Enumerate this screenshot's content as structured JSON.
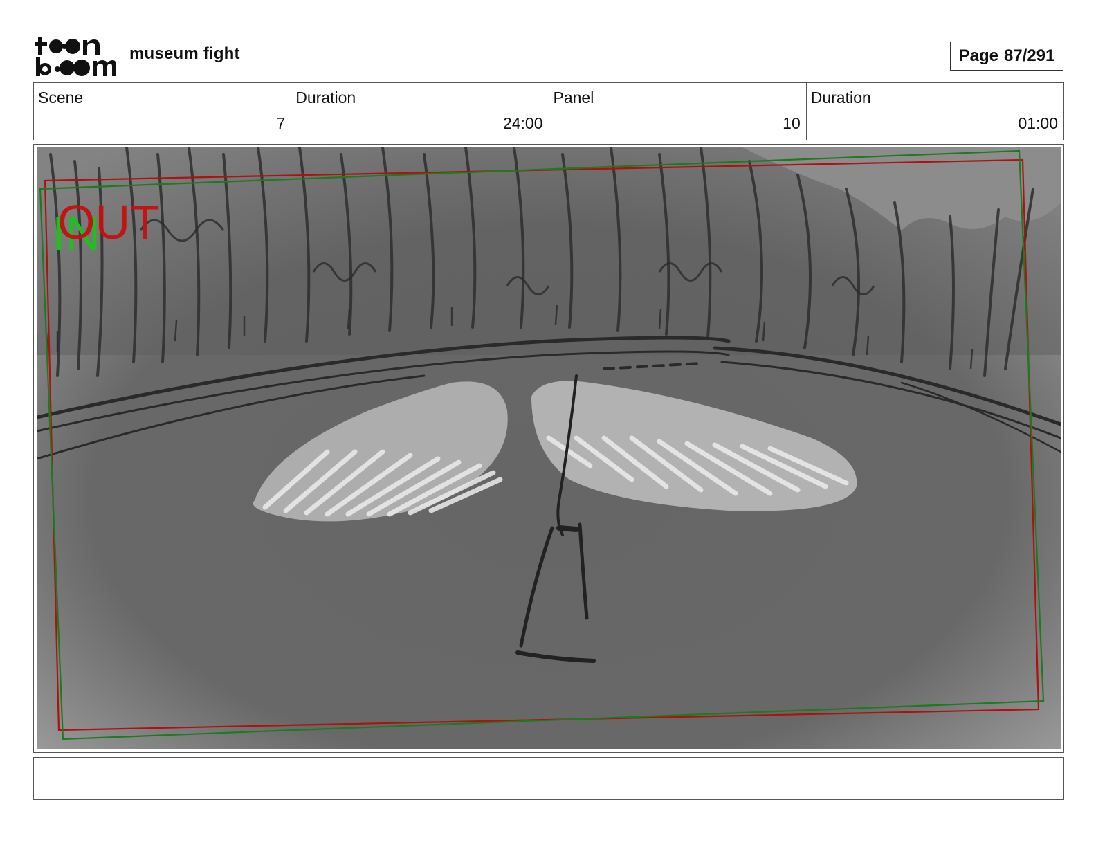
{
  "header": {
    "logo_text": "toon boom",
    "project_title": "museum fight",
    "page_label": "Page",
    "page_number": "87/291"
  },
  "info": {
    "scene_label": "Scene",
    "scene_value": "7",
    "scene_duration_label": "Duration",
    "scene_duration_value": "24:00",
    "panel_label": "Panel",
    "panel_value": "10",
    "panel_duration_label": "Duration",
    "panel_duration_value": "01:00"
  },
  "frame": {
    "in_label": "IN",
    "out_label": "OUT",
    "in_color": "#1fbf1f",
    "out_color": "#c41010",
    "in_frame_color": "#1e7a1e",
    "out_frame_color": "#b01010"
  },
  "notes": {
    "text": ""
  }
}
